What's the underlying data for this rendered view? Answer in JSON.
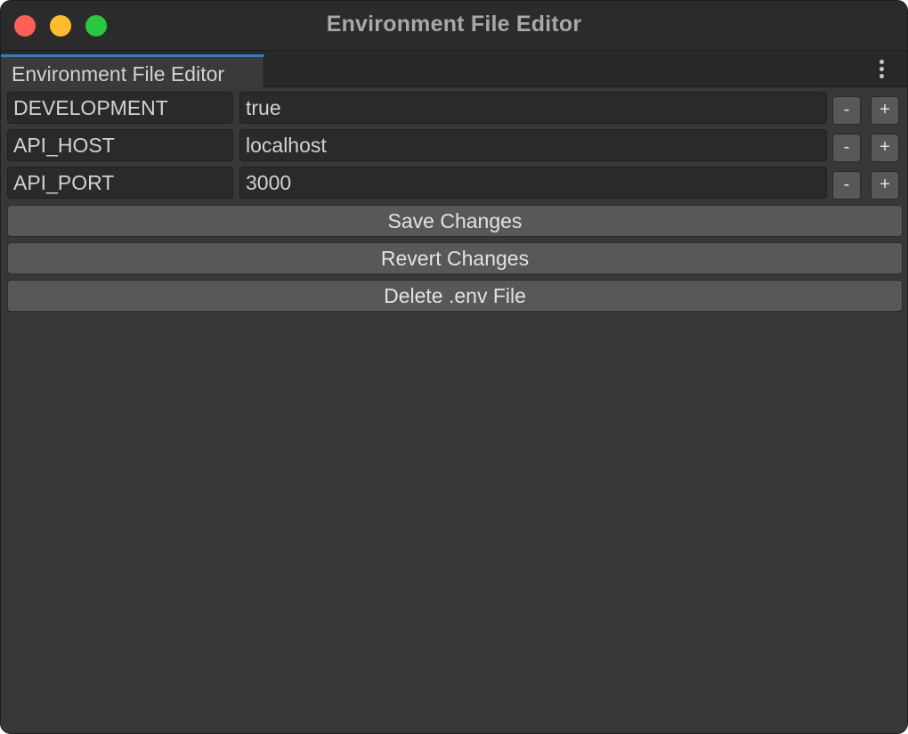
{
  "window": {
    "title": "Environment File Editor"
  },
  "tab": {
    "label": "Environment File Editor"
  },
  "entries": [
    {
      "key": "DEVELOPMENT",
      "value": "true",
      "remove_label": "-",
      "add_label": "+"
    },
    {
      "key": "API_HOST",
      "value": "localhost",
      "remove_label": "-",
      "add_label": "+"
    },
    {
      "key": "API_PORT",
      "value": "3000",
      "remove_label": "-",
      "add_label": "+"
    }
  ],
  "actions": {
    "save_label": "Save Changes",
    "revert_label": "Revert Changes",
    "delete_label": "Delete .env File"
  },
  "colors": {
    "accent": "#3a79bb",
    "close": "#fe5f57",
    "minimize": "#febc2e",
    "maximize": "#28c840",
    "background": "#383838"
  },
  "icons": {
    "menu": "more-vertical-icon"
  }
}
